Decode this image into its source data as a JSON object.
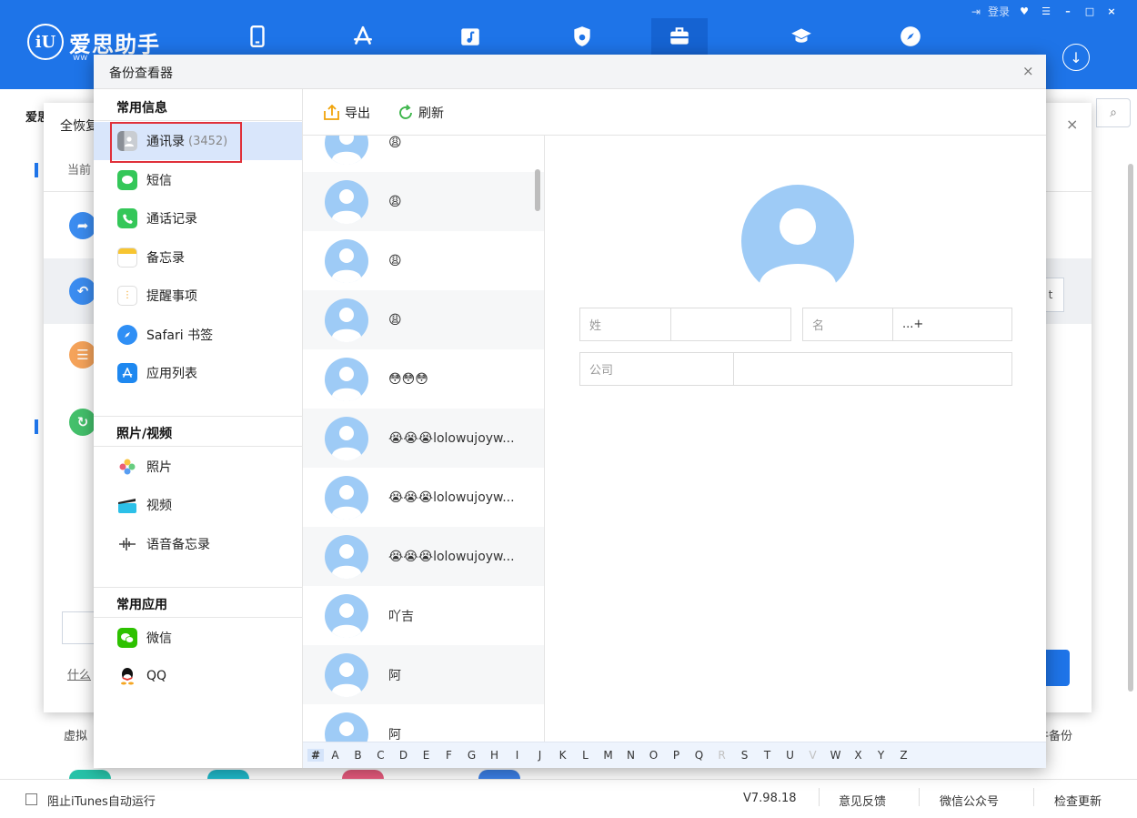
{
  "app": {
    "logo_text": "爱思助手",
    "logo_url": "ww"
  },
  "topbar": {
    "login_label": "登录",
    "window_controls": [
      "–",
      "□",
      "×"
    ]
  },
  "background": {
    "label": "爱思",
    "restore_title": "全恢复",
    "current_label": "当前",
    "question_link": "什么",
    "virtual_label": "虚拟",
    "backup_label": "件备份",
    "right_box_text": "t"
  },
  "dialog": {
    "title": "备份查看器",
    "close": "×"
  },
  "sidebar": {
    "sections": [
      {
        "title": "常用信息",
        "items": [
          {
            "label": "通讯录",
            "count": "(3452)",
            "icon": "contacts-icon",
            "active": true
          },
          {
            "label": "短信",
            "icon": "messages-icon"
          },
          {
            "label": "通话记录",
            "icon": "phone-icon"
          },
          {
            "label": "备忘录",
            "icon": "notes-icon"
          },
          {
            "label": "提醒事项",
            "icon": "reminders-icon"
          },
          {
            "label": "Safari 书签",
            "icon": "safari-icon"
          },
          {
            "label": "应用列表",
            "icon": "appstore-icon"
          }
        ]
      },
      {
        "title": "照片/视频",
        "items": [
          {
            "label": "照片",
            "icon": "photos-icon"
          },
          {
            "label": "视频",
            "icon": "video-icon"
          },
          {
            "label": "语音备忘录",
            "icon": "voice-memo-icon"
          }
        ]
      },
      {
        "title": "常用应用",
        "items": [
          {
            "label": "微信",
            "icon": "wechat-icon"
          },
          {
            "label": "QQ",
            "icon": "qq-icon"
          }
        ]
      }
    ]
  },
  "toolbar": {
    "export_label": "导出",
    "refresh_label": "刷新"
  },
  "contacts": [
    {
      "name": "😩"
    },
    {
      "name": "😩"
    },
    {
      "name": "😩"
    },
    {
      "name": "😩"
    },
    {
      "name": "😳😳😳"
    },
    {
      "name": "😭😭😭lolowujoyw..."
    },
    {
      "name": "😭😭😭lolowujoyw..."
    },
    {
      "name": "😭😭😭lolowujoyw..."
    },
    {
      "name": "吖吉"
    },
    {
      "name": "阿"
    },
    {
      "name": "阿"
    }
  ],
  "alphabet": [
    "#",
    "A",
    "B",
    "C",
    "D",
    "E",
    "F",
    "G",
    "H",
    "I",
    "J",
    "K",
    "L",
    "M",
    "N",
    "O",
    "P",
    "Q",
    "R",
    "S",
    "T",
    "U",
    "V",
    "W",
    "X",
    "Y",
    "Z"
  ],
  "alphabet_disabled": [
    "R",
    "V"
  ],
  "detail": {
    "last_name_label": "姓",
    "last_name_value": "",
    "first_name_label": "名",
    "first_name_value": "...+",
    "company_label": "公司",
    "company_value": ""
  },
  "statusbar": {
    "itunes_checkbox_label": "阻止iTunes自动运行",
    "version": "V7.98.18",
    "feedback": "意见反馈",
    "wechat_official": "微信公众号",
    "check_update": "检查更新"
  },
  "colors": {
    "brand_blue": "#1e74e8",
    "selected_bg": "#d9e6fb",
    "highlight_red": "#e0303a",
    "avatar_blue": "#9ecbf6"
  }
}
